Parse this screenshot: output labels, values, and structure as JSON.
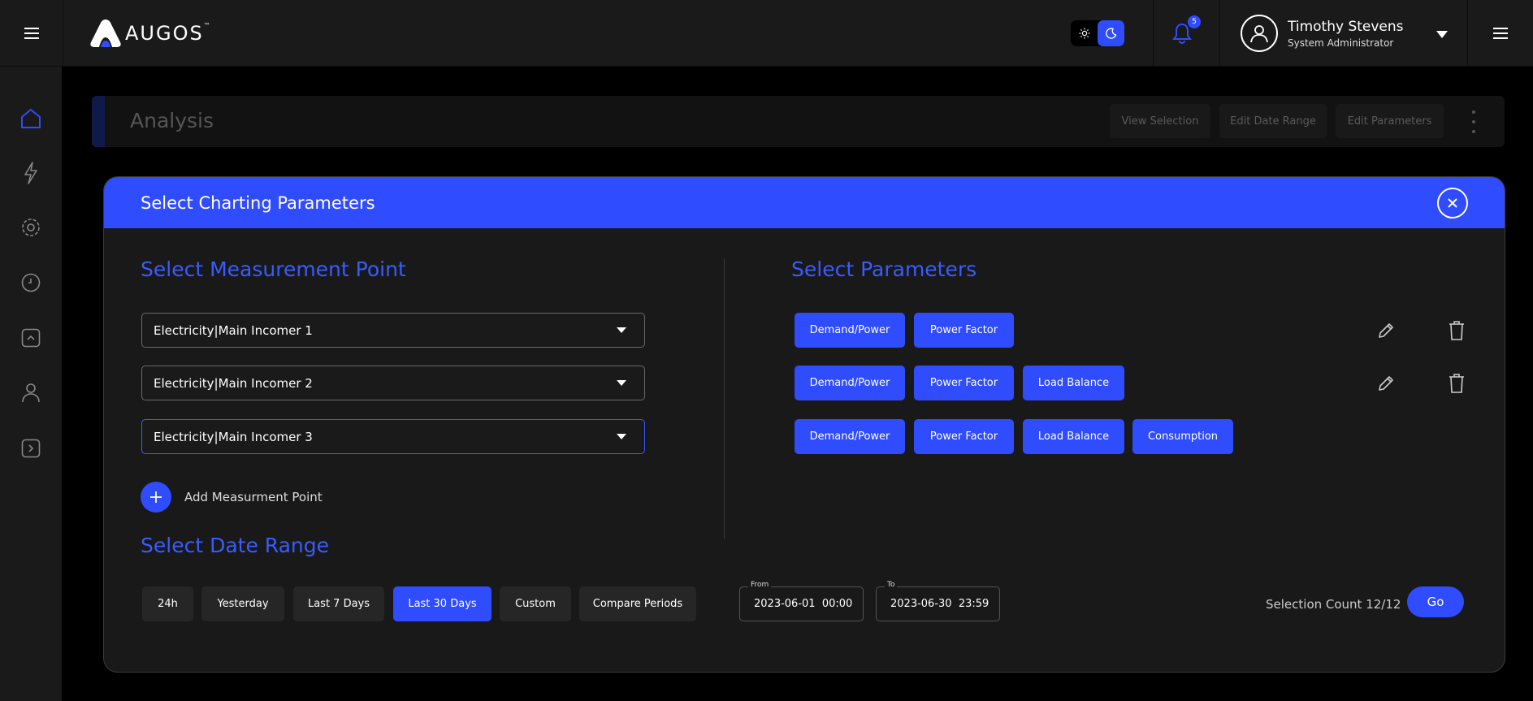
{
  "header": {
    "logo_text": "AUGOS",
    "logo_tm": "™",
    "notification_count": "5",
    "user_name": "Timothy Stevens",
    "user_role": "System Administrator"
  },
  "sidebar": {
    "items": [
      {
        "icon": "home-icon",
        "active": true
      },
      {
        "icon": "lightning-icon"
      },
      {
        "icon": "gear-icon"
      },
      {
        "icon": "clock-icon"
      },
      {
        "icon": "chevron-up-square-icon"
      },
      {
        "icon": "user-icon"
      },
      {
        "icon": "chevron-right-square-icon"
      }
    ]
  },
  "analysis": {
    "title": "Analysis",
    "buttons": [
      "View Selection",
      "Edit Date Range",
      "Edit Parameters"
    ]
  },
  "modal": {
    "title": "Select Charting Parameters",
    "measurement_title": "Select Measurement Point",
    "measurement_points": [
      "Electricity|Main Incomer 1",
      "Electricity|Main Incomer 2",
      "Electricity|Main Incomer 3"
    ],
    "add_measurement_label": "Add Measurment Point",
    "parameters_title": "Select Parameters",
    "parameter_rows": [
      [
        "Demand/Power",
        "Power Factor"
      ],
      [
        "Demand/Power",
        "Power Factor",
        "Load Balance"
      ],
      [
        "Demand/Power",
        "Power Factor",
        "Load Balance",
        "Consumption"
      ]
    ],
    "date_range_title": "Select Date Range",
    "date_ranges": [
      "24h",
      "Yesterday",
      "Last 7 Days",
      "Last 30 Days",
      "Custom",
      "Compare Periods"
    ],
    "active_date_range": "Last 30 Days",
    "from_label": "From",
    "from_value": "2023-06-01  00:00",
    "to_label": "To",
    "to_value": "2023-06-30  23:59",
    "selection_count": "Selection Count 12/12",
    "go_label": "Go"
  },
  "colors": {
    "accent": "#2f4cff",
    "section_title": "#3a5bff"
  }
}
